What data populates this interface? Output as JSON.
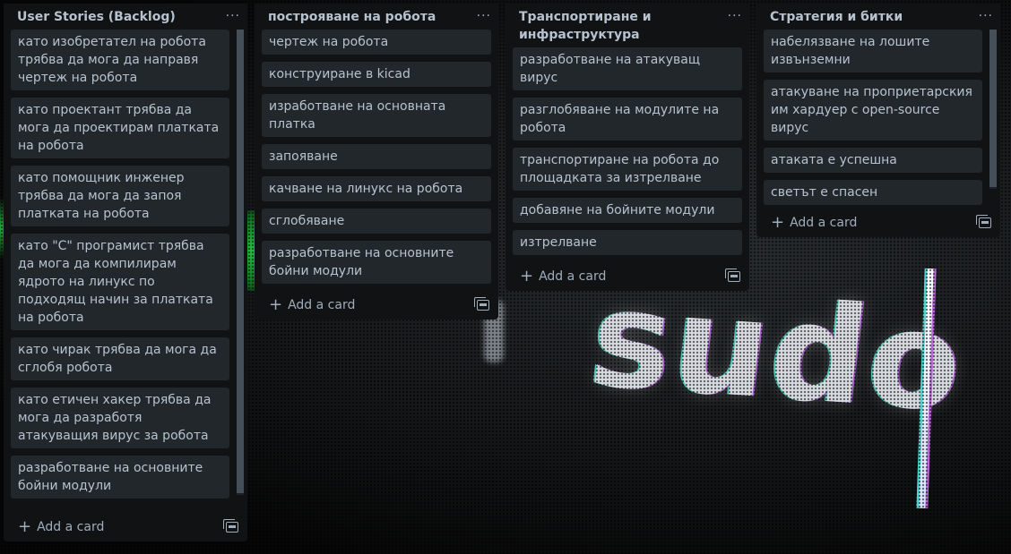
{
  "lists": [
    {
      "title": "User Stories (Backlog)",
      "menu": "···",
      "cards": [
        "като изобретател на робота трябва да мога да направя чертеж на робота",
        "като проектант трябва да мога да проектирам платката на робота",
        "като помощник инженер трябва да мога да запоя платката на робота",
        "като \"C\" програмист трябва да мога да компилирам ядрото на линукс по подходящ начин за платката на робота",
        "като чирак трябва да мога да сглобя робота",
        "като етичен хакер трябва да мога да разработя атакуващия вирус за робота",
        "разработване на основните бойни модули"
      ],
      "add_card": "Add a card"
    },
    {
      "title": "построяване на робота",
      "menu": "···",
      "cards": [
        "чертеж на робота",
        "конструиране в kicad",
        "изработване на основната платка",
        "запояване",
        "качване на линукс на робота",
        "сглобяване",
        "разработване на основните бойни модули"
      ],
      "add_card": "Add a card"
    },
    {
      "title": "Транспортиране и инфраструктура",
      "menu": "···",
      "cards": [
        "разработване на атакуващ вирус",
        "разглобяване на модулите на робота",
        "транспортиране на робота до площадката за изтрелване",
        "добавяне на бойните модули",
        "изтрелване"
      ],
      "add_card": "Add a card"
    },
    {
      "title": "Стратегия и битки",
      "menu": "···",
      "cards": [
        "набелязване на лошите извънземни",
        "атакуване на проприетарския им хардуер с open-source вирус",
        "атаката е успешна",
        "светът е спасен"
      ],
      "add_card": "Add a card"
    }
  ],
  "background": {
    "screen_text": "sudo"
  },
  "icons": {
    "add": "plus-icon",
    "template": "card-template-icon",
    "menu": "more-icon"
  }
}
